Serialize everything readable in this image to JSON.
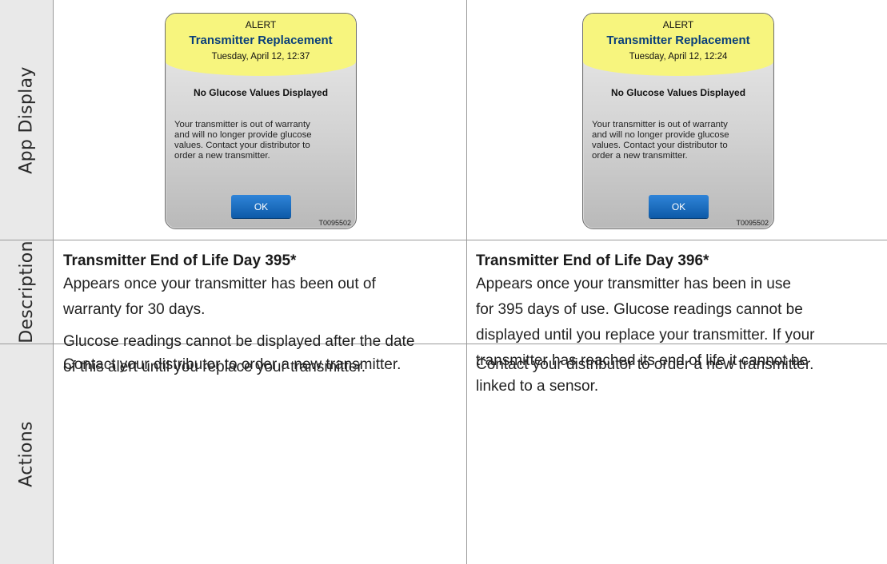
{
  "row_labels": {
    "app_display": "App Display",
    "description": "Description",
    "actions": "Actions"
  },
  "alerts": [
    {
      "tag": "ALERT",
      "title": "Transmitter Replacement",
      "date": "Tuesday, April 12, 12:37",
      "subtitle": "No Glucose Values Displayed",
      "lines": [
        "Your transmitter is out of warranty",
        "and will no longer provide glucose",
        "values. Contact your distributor to",
        "order a new transmitter."
      ],
      "button": "OK",
      "code": "T0095502"
    },
    {
      "tag": "ALERT",
      "title": "Transmitter Replacement",
      "date": "Tuesday, April 12, 12:24",
      "subtitle": "No Glucose Values Displayed",
      "lines": [
        "Your transmitter is out of warranty",
        "and will no longer provide glucose",
        "values. Contact your distributor to",
        "order a new transmitter."
      ],
      "button": "OK",
      "code": "T0095502"
    }
  ],
  "descriptions": [
    {
      "heading": "Transmitter End of Life Day 395*",
      "paragraph1_lines": [
        "Appears once your transmitter has been out of",
        "warranty for 30 days."
      ],
      "paragraph2_lines": [
        "Glucose readings cannot be displayed after the date",
        "of this alert until you replace your transmitter."
      ]
    },
    {
      "heading": "Transmitter End of Life Day 396*",
      "paragraph1_lines": [
        "Appears once your transmitter has been in use",
        "for 395 days of use. Glucose readings cannot be",
        "displayed until you replace your transmitter. If your",
        "transmitter has reached its end of life it cannot be",
        "linked to a sensor."
      ]
    }
  ],
  "actions": [
    "Contact your distributor to order a new transmitter.",
    "Contact your distributor to order a new transmitter."
  ],
  "colors": {
    "label_column": "#e9e9e9",
    "alert_header": "#f7f57e",
    "alert_title": "#0a3f7a",
    "ok_button": "#1a6fc4",
    "grid_line": "#9a9a9a"
  }
}
